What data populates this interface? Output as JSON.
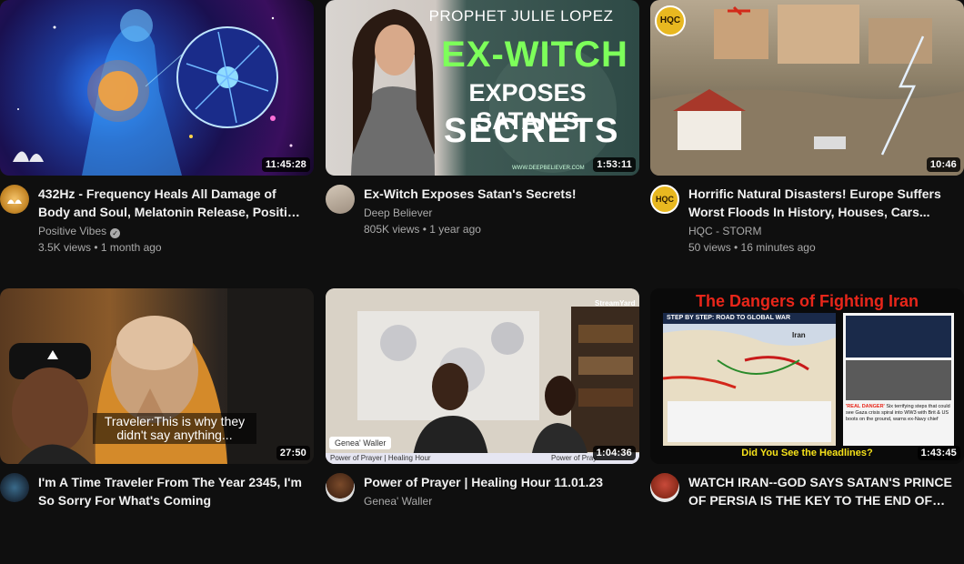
{
  "videos": [
    {
      "title": "432Hz - Frequency Heals All Damage of Body and Soul, Melatonin Release, Positive Energ...",
      "channel": "Positive Vibes",
      "verified": true,
      "stats": "3.5K views • 1 month ago",
      "duration": "11:45:28",
      "thumb_overlay": ""
    },
    {
      "title": "Ex-Witch Exposes Satan's Secrets!",
      "channel": "Deep Believer",
      "stats": "805K views • 1 year ago",
      "duration": "1:53:11",
      "thumb_text": {
        "top": "PROPHET JULIE LOPEZ",
        "line1": "EX-WITCH",
        "line2": "EXPOSES SATAN'S",
        "line3": "SECRETS",
        "footer": "WWW.DEEPBELIEVER.COM"
      }
    },
    {
      "title": "Horrific Natural Disasters! Europe Suffers Worst Floods In History, Houses, Cars...",
      "channel": "HQC - STORM",
      "stats": "50 views • 16 minutes ago",
      "duration": "10:46",
      "thumb_logo": "HQC",
      "avatar_logo": "HQC"
    },
    {
      "title": "I'm A Time Traveler From The Year 2345, I'm So Sorry For What's Coming",
      "channel": "",
      "stats": "",
      "duration": "27:50",
      "thumb_caption": "Traveler:This is why they didn't say anything..."
    },
    {
      "title": "Power of Prayer | Healing Hour 11.01.23",
      "channel": "Genea' Waller",
      "stats": "",
      "duration": "1:04:36",
      "thumb_text": {
        "name_tag": "Genea' Waller",
        "ticker_left": "Power of Prayer | Healing Hour",
        "ticker_right": "Power of Pray",
        "logo": "StreamYard"
      }
    },
    {
      "title": "WATCH IRAN--GOD SAYS SATAN'S PRINCE OF PERSIA IS THE KEY TO THE END OF THE...",
      "channel": "",
      "stats": "",
      "duration": "1:43:45",
      "thumb_text": {
        "headline": "The Dangers of Fighting Iran",
        "map_title": "STEP BY STEP: ROAD TO GLOBAL WAR",
        "map_label": "Iran",
        "red_flag": "'REAL DANGER'",
        "news": "Six terrifying steps that could see Gaza crisis spiral into WW3 with Brit & US boots on the ground, warns ex-Navy chief",
        "footer": "Did You See the Headlines?"
      }
    }
  ]
}
